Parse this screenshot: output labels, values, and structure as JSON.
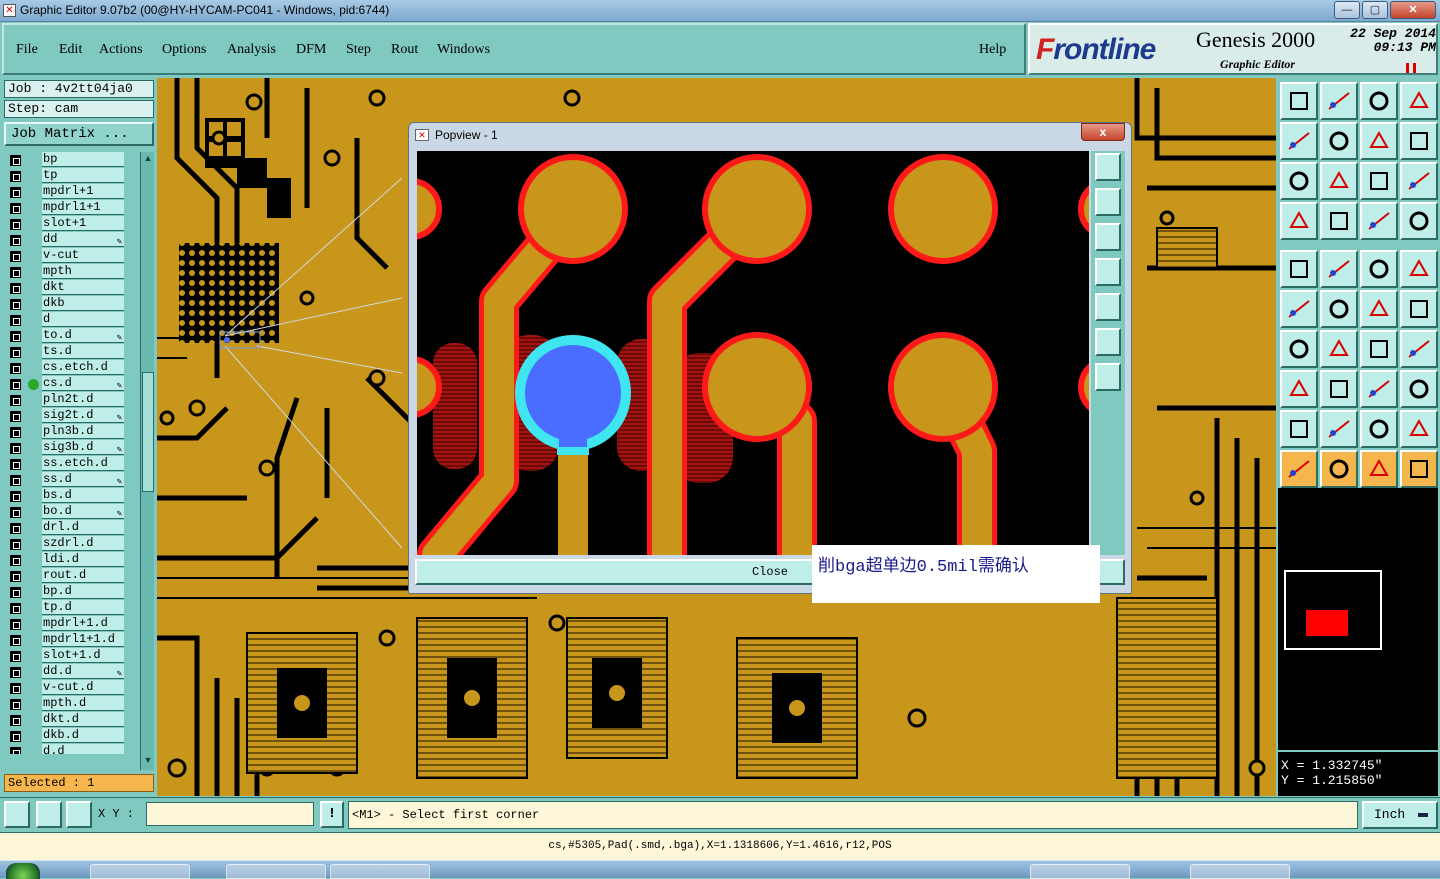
{
  "window": {
    "title": "Graphic Editor 9.07b2 (00@HY-HYCAM-PC041 - Windows, pid:6744)",
    "minimize": "—",
    "maximize": "▢",
    "close": "✕"
  },
  "menu": {
    "items": [
      "File",
      "Edit",
      "Actions",
      "Options",
      "Analysis",
      "DFM",
      "Step",
      "Rout",
      "Windows"
    ],
    "help": "Help"
  },
  "brand": {
    "logo_prefix": "F",
    "logo_rest": "rontline",
    "product": "Genesis 2000",
    "subtitle": "Graphic Editor",
    "date": "22 Sep 2014",
    "time": "09:13 PM"
  },
  "job": {
    "job_label": "Job : 4v2tt04ja0",
    "step_label": "Step: cam",
    "matrix_button": "Job Matrix ..."
  },
  "layers": [
    {
      "name": "bp",
      "dot": false,
      "pen": false
    },
    {
      "name": "tp",
      "dot": false,
      "pen": false
    },
    {
      "name": "mpdrl+1",
      "dot": false,
      "pen": false
    },
    {
      "name": "mpdrl1+1",
      "dot": false,
      "pen": false
    },
    {
      "name": "slot+1",
      "dot": false,
      "pen": false
    },
    {
      "name": "dd",
      "dot": false,
      "pen": true
    },
    {
      "name": "v-cut",
      "dot": false,
      "pen": false
    },
    {
      "name": "mpth",
      "dot": false,
      "pen": false
    },
    {
      "name": "dkt",
      "dot": false,
      "pen": false
    },
    {
      "name": "dkb",
      "dot": false,
      "pen": false
    },
    {
      "name": "d",
      "dot": false,
      "pen": false
    },
    {
      "name": "to.d",
      "dot": false,
      "pen": true
    },
    {
      "name": "ts.d",
      "dot": false,
      "pen": false
    },
    {
      "name": "cs.etch.d",
      "dot": false,
      "pen": false
    },
    {
      "name": "cs.d",
      "dot": true,
      "pen": true
    },
    {
      "name": "pln2t.d",
      "dot": false,
      "pen": false
    },
    {
      "name": "sig2t.d",
      "dot": false,
      "pen": true
    },
    {
      "name": "pln3b.d",
      "dot": false,
      "pen": false
    },
    {
      "name": "sig3b.d",
      "dot": false,
      "pen": true
    },
    {
      "name": "ss.etch.d",
      "dot": false,
      "pen": false
    },
    {
      "name": "ss.d",
      "dot": false,
      "pen": true
    },
    {
      "name": "bs.d",
      "dot": false,
      "pen": false
    },
    {
      "name": "bo.d",
      "dot": false,
      "pen": true
    },
    {
      "name": "drl.d",
      "dot": false,
      "pen": false
    },
    {
      "name": "szdrl.d",
      "dot": false,
      "pen": false
    },
    {
      "name": "ldi.d",
      "dot": false,
      "pen": false
    },
    {
      "name": "rout.d",
      "dot": false,
      "pen": false
    },
    {
      "name": "bp.d",
      "dot": false,
      "pen": false
    },
    {
      "name": "tp.d",
      "dot": false,
      "pen": false
    },
    {
      "name": "mpdrl+1.d",
      "dot": false,
      "pen": false
    },
    {
      "name": "mpdrl1+1.d",
      "dot": false,
      "pen": false
    },
    {
      "name": "slot+1.d",
      "dot": false,
      "pen": false
    },
    {
      "name": "dd.d",
      "dot": false,
      "pen": true
    },
    {
      "name": "v-cut.d",
      "dot": false,
      "pen": false
    },
    {
      "name": "mpth.d",
      "dot": false,
      "pen": false
    },
    {
      "name": "dkt.d",
      "dot": false,
      "pen": false
    },
    {
      "name": "dkb.d",
      "dot": false,
      "pen": false
    },
    {
      "name": "d.d",
      "dot": false,
      "pen": false
    }
  ],
  "selected": "Selected : 1",
  "popview": {
    "title": "Popview - 1",
    "close_x": "x",
    "close_button": "Close"
  },
  "note": "削bga超单边0.5mil需确认",
  "coords": {
    "x": "X = 1.332745\"",
    "y": "Y = 1.215850\""
  },
  "bottom": {
    "xy_label": "X Y :",
    "xy_value": "",
    "excl": "!",
    "prompt": "<M1> - Select first corner",
    "unit": "Inch"
  },
  "status": "cs,#5305,Pad(.smd,.bga),X=1.1318606,Y=1.4616,r12,POS",
  "colors": {
    "copper": "#c8961a",
    "pad_outline": "#ff1a1a",
    "selected_pad": "#4a6cff",
    "selected_ring": "#3fe6f0",
    "ui_teal": "#7fc9c1"
  }
}
